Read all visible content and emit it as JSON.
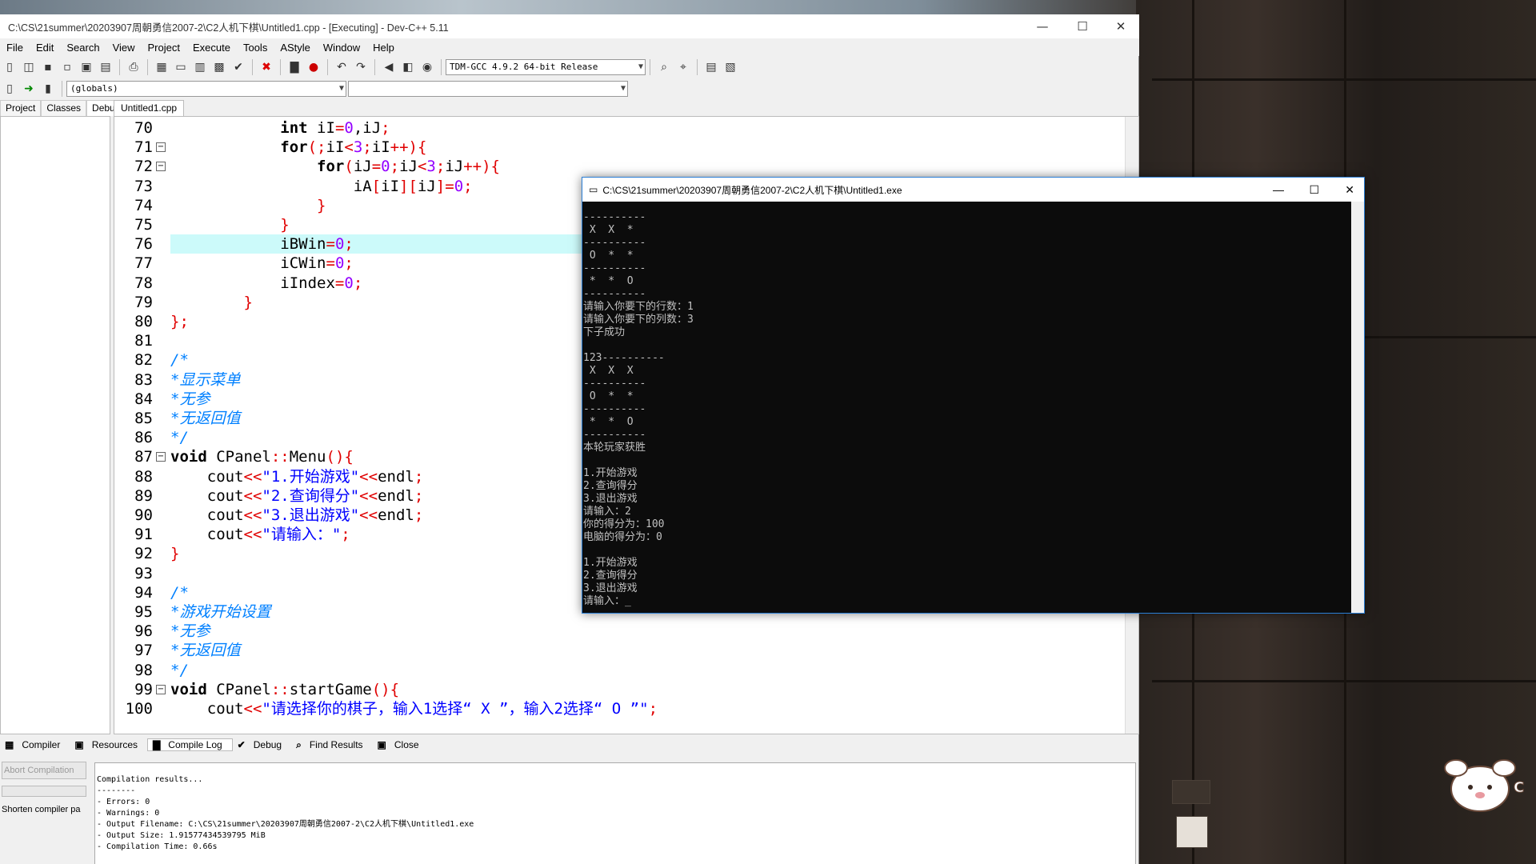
{
  "devcpp": {
    "title": "C:\\CS\\21summer\\20203907周朝勇信2007-2\\C2人机下棋\\Untitled1.cpp - [Executing] - Dev-C++ 5.11",
    "menu": [
      "File",
      "Edit",
      "Search",
      "View",
      "Project",
      "Execute",
      "Tools",
      "AStyle",
      "Window",
      "Help"
    ],
    "compiler_combo": "TDM-GCC 4.9.2 64-bit Release",
    "globals_combo": "(globals)",
    "left_tabs": [
      "Project",
      "Classes",
      "Debug"
    ],
    "editor_tab": "Untitled1.cpp",
    "bottom_tabs": [
      "Compiler",
      "Resources",
      "Compile Log",
      "Debug",
      "Find Results",
      "Close"
    ],
    "abort_button": "Abort Compilation",
    "shorten_label": "Shorten compiler pa",
    "log_lines": [
      "Compilation results...",
      "--------",
      "- Errors: 0",
      "- Warnings: 0",
      "- Output Filename: C:\\CS\\21summer\\20203907周朝勇信2007-2\\C2人机下棋\\Untitled1.exe",
      "- Output Size: 1.91577434539795 MiB",
      "- Compilation Time: 0.66s"
    ]
  },
  "code": [
    {
      "n": "70",
      "t": [
        [
          "            ",
          ""
        ],
        [
          "int",
          "kw"
        ],
        [
          " iI",
          ""
        ],
        [
          "=",
          "op"
        ],
        [
          "0",
          "num"
        ],
        [
          ",iJ",
          ""
        ],
        [
          ";",
          "op"
        ]
      ]
    },
    {
      "n": "71",
      "t": [
        [
          "            ",
          ""
        ],
        [
          "for",
          "kw"
        ],
        [
          "(;",
          "op"
        ],
        [
          "iI",
          ""
        ],
        [
          "<",
          "op"
        ],
        [
          "3",
          "num"
        ],
        [
          ";",
          "op"
        ],
        [
          "iI",
          ""
        ],
        [
          "++){",
          "op"
        ]
      ]
    },
    {
      "n": "72",
      "t": [
        [
          "                ",
          ""
        ],
        [
          "for",
          "kw"
        ],
        [
          "(",
          "op"
        ],
        [
          "iJ",
          ""
        ],
        [
          "=",
          "op"
        ],
        [
          "0",
          "num"
        ],
        [
          ";",
          "op"
        ],
        [
          "iJ",
          ""
        ],
        [
          "<",
          "op"
        ],
        [
          "3",
          "num"
        ],
        [
          ";",
          "op"
        ],
        [
          "iJ",
          ""
        ],
        [
          "++){",
          "op"
        ]
      ]
    },
    {
      "n": "73",
      "t": [
        [
          "                    ",
          ""
        ],
        [
          "iA",
          ""
        ],
        [
          "[",
          "op"
        ],
        [
          "iI",
          ""
        ],
        [
          "][",
          "op"
        ],
        [
          "iJ",
          ""
        ],
        [
          "]=",
          "op"
        ],
        [
          "0",
          "num"
        ],
        [
          ";",
          "op"
        ]
      ]
    },
    {
      "n": "74",
      "t": [
        [
          "                ",
          ""
        ],
        [
          "}",
          "op"
        ]
      ]
    },
    {
      "n": "75",
      "t": [
        [
          "            ",
          ""
        ],
        [
          "}",
          "op"
        ]
      ]
    },
    {
      "n": "76",
      "t": [
        [
          "            ",
          ""
        ],
        [
          "iBWin",
          ""
        ],
        [
          "=",
          "op"
        ],
        [
          "0",
          "num"
        ],
        [
          ";",
          "op"
        ]
      ]
    },
    {
      "n": "77",
      "t": [
        [
          "            ",
          ""
        ],
        [
          "iCWin",
          ""
        ],
        [
          "=",
          "op"
        ],
        [
          "0",
          "num"
        ],
        [
          ";",
          "op"
        ]
      ]
    },
    {
      "n": "78",
      "t": [
        [
          "            ",
          ""
        ],
        [
          "iIndex",
          ""
        ],
        [
          "=",
          "op"
        ],
        [
          "0",
          "num"
        ],
        [
          ";",
          "op"
        ]
      ]
    },
    {
      "n": "79",
      "t": [
        [
          "        ",
          ""
        ],
        [
          "}",
          "op"
        ]
      ]
    },
    {
      "n": "80",
      "t": [
        [
          "};",
          "op"
        ]
      ]
    },
    {
      "n": "81",
      "t": [
        [
          "",
          ""
        ]
      ]
    },
    {
      "n": "82",
      "t": [
        [
          "/*",
          "cm"
        ]
      ]
    },
    {
      "n": "83",
      "t": [
        [
          "*显示菜单",
          "cm"
        ]
      ]
    },
    {
      "n": "84",
      "t": [
        [
          "*无参",
          "cm"
        ]
      ]
    },
    {
      "n": "85",
      "t": [
        [
          "*无返回值",
          "cm"
        ]
      ]
    },
    {
      "n": "86",
      "t": [
        [
          "*/",
          "cm"
        ]
      ]
    },
    {
      "n": "87",
      "t": [
        [
          "void",
          "kw"
        ],
        [
          " CPanel",
          ""
        ],
        [
          "::",
          "op"
        ],
        [
          "Menu",
          ""
        ],
        [
          "(){",
          "op"
        ]
      ]
    },
    {
      "n": "88",
      "t": [
        [
          "    cout",
          ""
        ],
        [
          "<<",
          "op"
        ],
        [
          "\"1.开始游戏\"",
          "str"
        ],
        [
          "<<",
          "op"
        ],
        [
          "endl",
          ""
        ],
        [
          ";",
          "op"
        ]
      ]
    },
    {
      "n": "89",
      "t": [
        [
          "    cout",
          ""
        ],
        [
          "<<",
          "op"
        ],
        [
          "\"2.查询得分\"",
          "str"
        ],
        [
          "<<",
          "op"
        ],
        [
          "endl",
          ""
        ],
        [
          ";",
          "op"
        ]
      ]
    },
    {
      "n": "90",
      "t": [
        [
          "    cout",
          ""
        ],
        [
          "<<",
          "op"
        ],
        [
          "\"3.退出游戏\"",
          "str"
        ],
        [
          "<<",
          "op"
        ],
        [
          "endl",
          ""
        ],
        [
          ";",
          "op"
        ]
      ]
    },
    {
      "n": "91",
      "t": [
        [
          "    cout",
          ""
        ],
        [
          "<<",
          "op"
        ],
        [
          "\"请输入：\"",
          "str"
        ],
        [
          ";",
          "op"
        ]
      ]
    },
    {
      "n": "92",
      "t": [
        [
          "}",
          "op"
        ]
      ]
    },
    {
      "n": "93",
      "t": [
        [
          "",
          ""
        ]
      ]
    },
    {
      "n": "94",
      "t": [
        [
          "/*",
          "cm"
        ]
      ]
    },
    {
      "n": "95",
      "t": [
        [
          "*游戏开始设置",
          "cm"
        ]
      ]
    },
    {
      "n": "96",
      "t": [
        [
          "*无参",
          "cm"
        ]
      ]
    },
    {
      "n": "97",
      "t": [
        [
          "*无返回值",
          "cm"
        ]
      ]
    },
    {
      "n": "98",
      "t": [
        [
          "*/",
          "cm"
        ]
      ]
    },
    {
      "n": "99",
      "t": [
        [
          "void",
          "kw"
        ],
        [
          " CPanel",
          ""
        ],
        [
          "::",
          "op"
        ],
        [
          "startGame",
          ""
        ],
        [
          "(){",
          "op"
        ]
      ]
    },
    {
      "n": "100",
      "t": [
        [
          "    cout",
          ""
        ],
        [
          "<<",
          "op"
        ],
        [
          "\"请选择你的棋子，输入1选择“ X ”，输入2选择“ O ”\"",
          "str"
        ],
        [
          ";",
          "op"
        ]
      ]
    }
  ],
  "console": {
    "title": "C:\\CS\\21summer\\20203907周朝勇信2007-2\\C2人机下棋\\Untitled1.exe",
    "lines": [
      "----------",
      " X  X  *",
      "----------",
      " O  *  *",
      "----------",
      " *  *  O",
      "----------",
      "请输入你要下的行数：1",
      "请输入你要下的列数：3",
      "下子成功",
      "",
      "123----------",
      " X  X  X",
      "----------",
      " O  *  *",
      "----------",
      " *  *  O",
      "----------",
      "本轮玩家获胜",
      "",
      "1.开始游戏",
      "2.查询得分",
      "3.退出游戏",
      "请输入：2",
      "你的得分为：100",
      "电脑的得分为：0",
      "",
      "1.开始游戏",
      "2.查询得分",
      "3.退出游戏",
      "请输入：_"
    ]
  }
}
